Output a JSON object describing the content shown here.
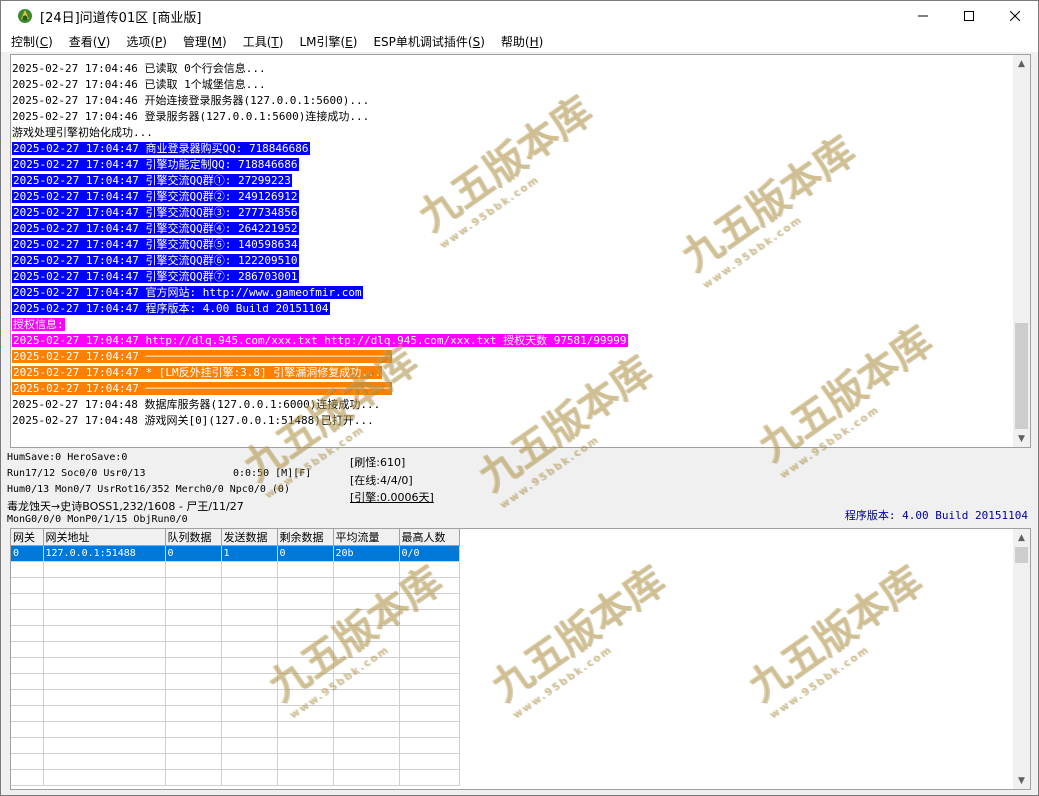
{
  "window": {
    "title": "[24日]问道传01区 [商业版]",
    "minimize_glyph": "—",
    "maximize_glyph": "☐",
    "close_glyph": "✕"
  },
  "menu": [
    {
      "label": "控制(",
      "key": "C",
      "end": ")"
    },
    {
      "label": "查看(",
      "key": "V",
      "end": ")"
    },
    {
      "label": "选项(",
      "key": "P",
      "end": ")"
    },
    {
      "label": "管理(",
      "key": "M",
      "end": ")"
    },
    {
      "label": "工具(",
      "key": "T",
      "end": ")"
    },
    {
      "label": "LM引擎(",
      "key": "E",
      "end": ")"
    },
    {
      "label": "ESP单机调试插件(",
      "key": "S",
      "end": ")"
    },
    {
      "label": "帮助(",
      "key": "H",
      "end": ")"
    }
  ],
  "log": [
    {
      "text": "2025-02-27 17:04:46 已读取 0个行会信息...",
      "style": ""
    },
    {
      "text": "2025-02-27 17:04:46 已读取 1个城堡信息...",
      "style": ""
    },
    {
      "text": "2025-02-27 17:04:46 开始连接登录服务器(127.0.0.1:5600)...",
      "style": ""
    },
    {
      "text": "2025-02-27 17:04:46 登录服务器(127.0.0.1:5600)连接成功...",
      "style": ""
    },
    {
      "text": "游戏处理引擎初始化成功...",
      "style": ""
    },
    {
      "text": "2025-02-27 17:04:47 商业登录器购买QQ: 718846686",
      "style": "blue"
    },
    {
      "text": "2025-02-27 17:04:47 引擎功能定制QQ: 718846686",
      "style": "blue"
    },
    {
      "text": "2025-02-27 17:04:47 引擎交流QQ群①: 27299223",
      "style": "blue"
    },
    {
      "text": "2025-02-27 17:04:47 引擎交流QQ群②: 249126912",
      "style": "blue"
    },
    {
      "text": "2025-02-27 17:04:47 引擎交流QQ群③: 277734856",
      "style": "blue"
    },
    {
      "text": "2025-02-27 17:04:47 引擎交流QQ群④: 264221952",
      "style": "blue"
    },
    {
      "text": "2025-02-27 17:04:47 引擎交流QQ群⑤: 140598634",
      "style": "blue"
    },
    {
      "text": "2025-02-27 17:04:47 引擎交流QQ群⑥: 122209510",
      "style": "blue"
    },
    {
      "text": "2025-02-27 17:04:47 引擎交流QQ群⑦: 286703001",
      "style": "blue"
    },
    {
      "text": "2025-02-27 17:04:47 官方网站: http://www.gameofmir.com",
      "style": "blue"
    },
    {
      "text": "2025-02-27 17:04:47 程序版本: 4.00 Build 20151104",
      "style": "blue"
    },
    {
      "text": "授权信息:",
      "style": "magenta"
    },
    {
      "text": "2025-02-27 17:04:47 http://dlq.945.com/xxx.txt http://dlq.945.com/xxx.txt 授权天数 97581/99999",
      "style": "magenta"
    },
    {
      "text": "2025-02-27 17:04:47 ─────────────────────────────────────",
      "style": "orange"
    },
    {
      "text": "2025-02-27 17:04:47 * [LM反外挂引擎:3.8] 引擎漏洞修复成功...",
      "style": "orange"
    },
    {
      "text": "2025-02-27 17:04:47 ─────────────────────────────────────",
      "style": "orange"
    },
    {
      "text": "2025-02-27 17:04:48 数据库服务器(127.0.0.1:6000)连接成功...",
      "style": ""
    },
    {
      "text": "2025-02-27 17:04:48 游戏网关[0](127.0.0.1:51488)已打开...",
      "style": ""
    }
  ],
  "status": {
    "line1": "HumSave:0 HeroSave:0",
    "line2a": "Run17/12 Soc0/0 Usr0/13",
    "line2b": "0:0:50 [M][F]",
    "line3": "Hum0/13 Mon0/7 UsrRot16/352 Merch0/0 Npc0/0 (0)",
    "line4": "毒龙蚀天→史诗BOSS1,232/1608 - 尸王/11/27",
    "line5": "MonG0/0/0 MonP0/1/15 ObjRun0/0",
    "refresh": "[刷怪:610]",
    "online": "[在线:4/4/0]",
    "engine": "[引擎:0.0006天]",
    "version": "程序版本: 4.00 Build 20151104"
  },
  "grid": {
    "headers": [
      "网关",
      "网关地址",
      "队列数据",
      "发送数据",
      "剩余数据",
      "平均流量",
      "最高人数"
    ],
    "rows": [
      [
        "0",
        "127.0.0.1:51488",
        "0",
        "1",
        "0",
        "20b",
        "0/0"
      ]
    ]
  },
  "watermark": {
    "main": "九五版本库",
    "sub": "www.95bbk.com"
  },
  "colors": {
    "blue": "#0000ff",
    "magenta": "#ff00ff",
    "orange": "#ff7f00",
    "selected": "#0078d7"
  }
}
